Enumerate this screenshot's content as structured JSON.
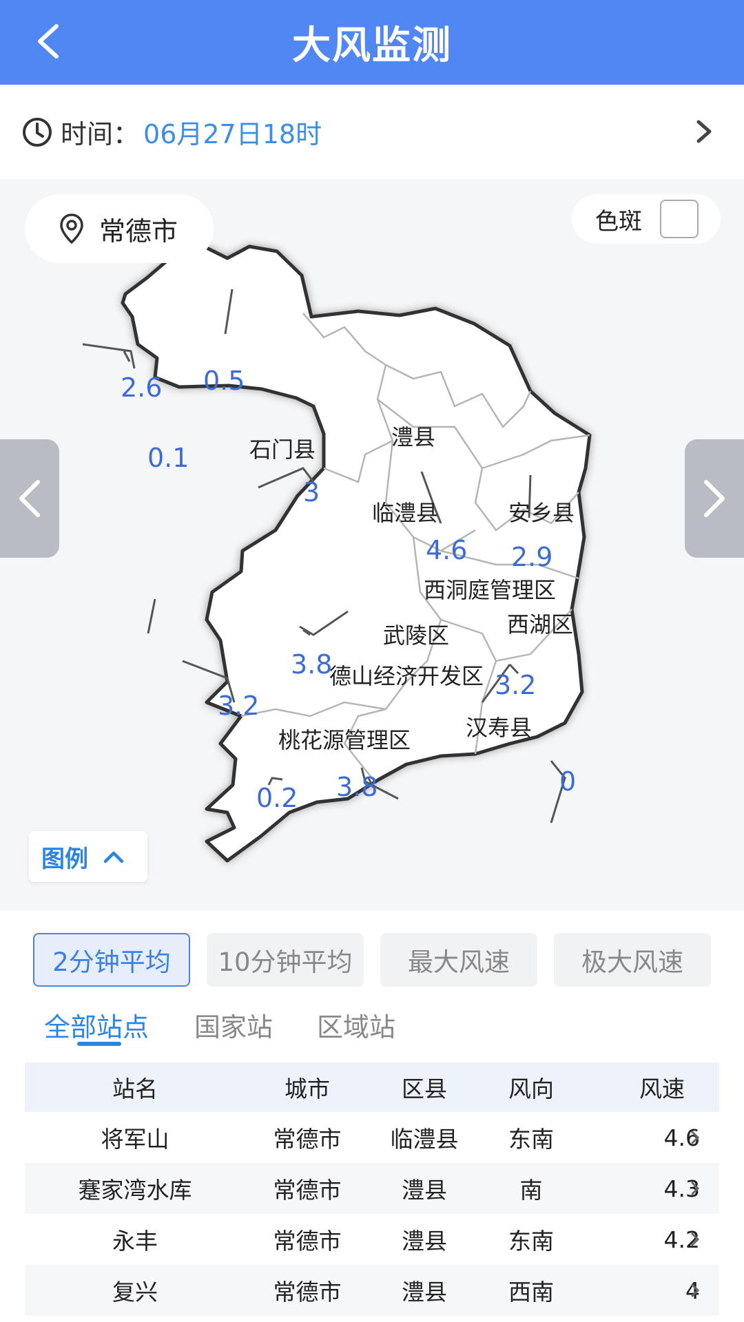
{
  "header": {
    "title": "大风监测"
  },
  "time": {
    "label": "时间：",
    "value": "06月27日18时"
  },
  "map": {
    "city": "常德市",
    "color_spot_label": "色斑",
    "legend_label": "图例",
    "regions": [
      {
        "name": "石门县"
      },
      {
        "name": "澧县"
      },
      {
        "name": "临澧县"
      },
      {
        "name": "安乡县"
      },
      {
        "name": "西洞庭管理区"
      },
      {
        "name": "西湖区"
      },
      {
        "name": "武陵区"
      },
      {
        "name": "德山经济开发区"
      },
      {
        "name": "汉寿县"
      },
      {
        "name": "桃花源管理区"
      }
    ],
    "values": [
      "2.6",
      "0.5",
      "0.1",
      "3",
      "4.6",
      "2.9",
      "3.8",
      "3.2",
      "3.2",
      "0.2",
      "3.8",
      "0"
    ]
  },
  "segments": [
    "2分钟平均",
    "10分钟平均",
    "最大风速",
    "极大风速"
  ],
  "tabs": [
    "全部站点",
    "国家站",
    "区域站"
  ],
  "table": {
    "headers": [
      "站名",
      "城市",
      "区县",
      "风向",
      "风速"
    ],
    "rows": [
      [
        "将军山",
        "常德市",
        "临澧县",
        "东南",
        "4.6"
      ],
      [
        "蹇家湾水库",
        "常德市",
        "澧县",
        "南",
        "4.3"
      ],
      [
        "永丰",
        "常德市",
        "澧县",
        "东南",
        "4.2"
      ],
      [
        "复兴",
        "常德市",
        "澧县",
        "西南",
        "4"
      ]
    ]
  },
  "colors": {
    "header": "#5187f3",
    "accent": "#2a86e0",
    "value_blue": "#3d6bd6"
  }
}
